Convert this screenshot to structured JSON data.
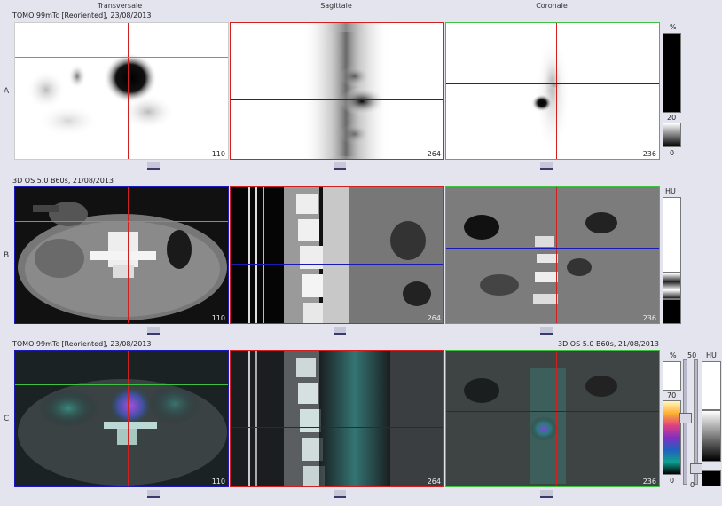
{
  "columns": {
    "transversal": "Transversale",
    "sagittal": "Sagittale",
    "coronal": "Coronale"
  },
  "rows": [
    {
      "letter": "A",
      "title": "TOMO 99mTc [Reoriented], 23/08/2013"
    },
    {
      "letter": "B",
      "title": "3D  OS  5.0  B60s, 21/08/2013"
    },
    {
      "letter": "C",
      "title": "TOMO 99mTc [Reoriented], 23/08/2013",
      "title_right": "3D  OS  5.0  B60s, 21/08/2013"
    }
  ],
  "slice_numbers": {
    "transversal": "110",
    "sagittal": "264",
    "coronal": "236"
  },
  "scale_a": {
    "unit": "%",
    "upper": "20",
    "lower": "0"
  },
  "scale_b": {
    "unit": "HU"
  },
  "scale_c": {
    "unit_pct": "%",
    "unit_hu": "HU",
    "top": "50",
    "upper": "70",
    "lower": "0",
    "hu_lower": "0"
  },
  "colors": {
    "crosshair_red": "#d02020",
    "crosshair_green": "#40c040",
    "crosshair_blue": "#1a1ab8"
  }
}
